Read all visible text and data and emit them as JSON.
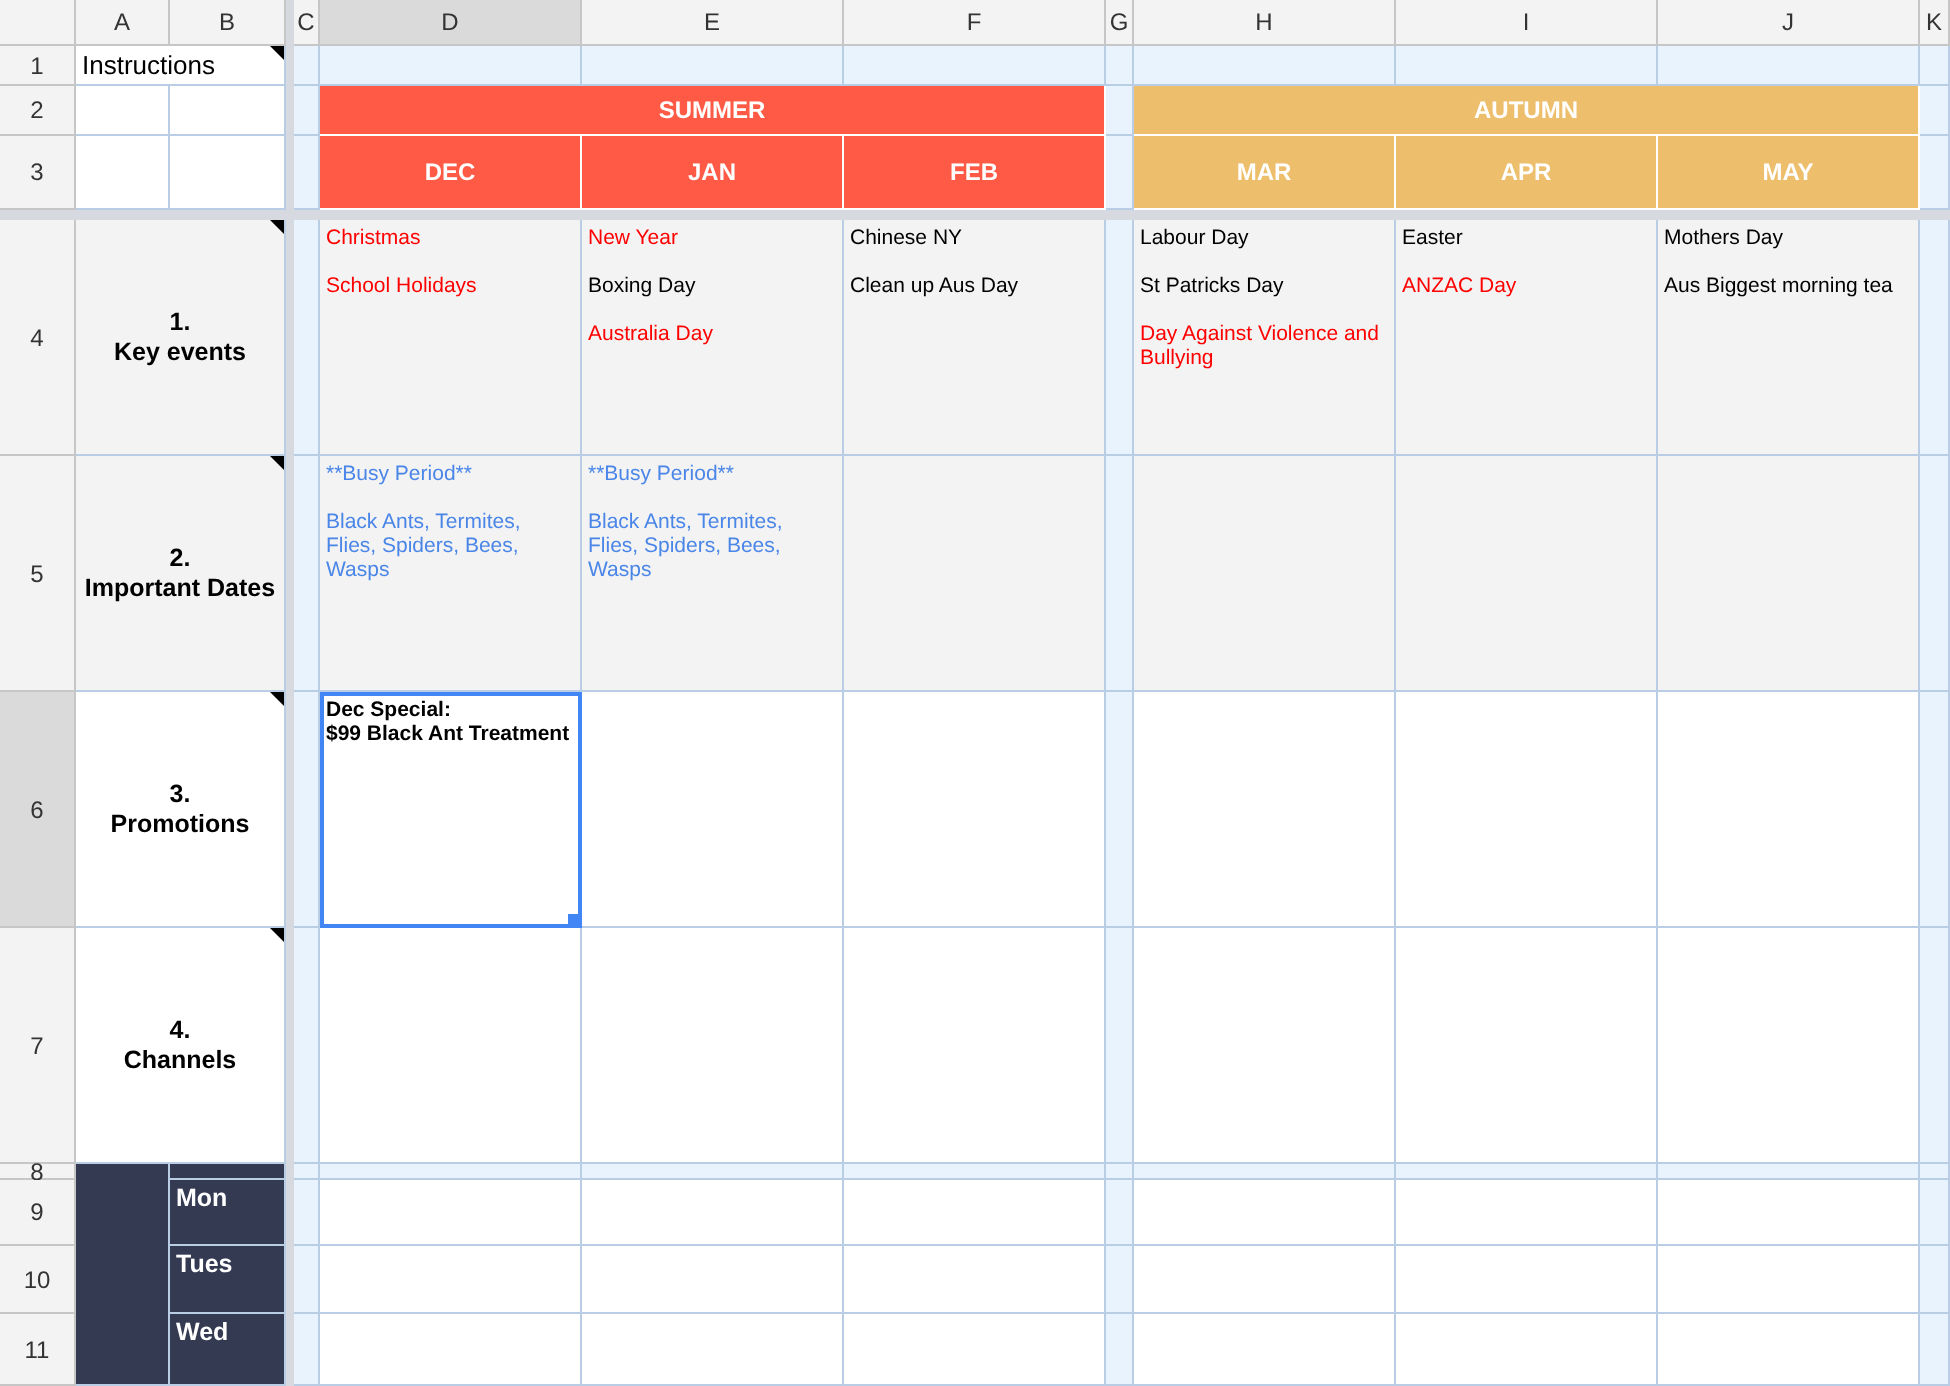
{
  "columns": [
    {
      "label": "A",
      "selected": false
    },
    {
      "label": "B",
      "selected": false
    },
    {
      "label": "C",
      "selected": false
    },
    {
      "label": "D",
      "selected": true
    },
    {
      "label": "E",
      "selected": false
    },
    {
      "label": "F",
      "selected": false
    },
    {
      "label": "G",
      "selected": false
    },
    {
      "label": "H",
      "selected": false
    },
    {
      "label": "I",
      "selected": false
    },
    {
      "label": "J",
      "selected": false
    },
    {
      "label": "K",
      "selected": false
    }
  ],
  "rows": [
    {
      "label": "1",
      "selected": false
    },
    {
      "label": "2",
      "selected": false
    },
    {
      "label": "3",
      "selected": false
    },
    {
      "label": "4",
      "selected": false
    },
    {
      "label": "5",
      "selected": false
    },
    {
      "label": "6",
      "selected": true
    },
    {
      "label": "7",
      "selected": false
    },
    {
      "label": "8",
      "selected": false
    },
    {
      "label": "9",
      "selected": false
    },
    {
      "label": "10",
      "selected": false
    },
    {
      "label": "11",
      "selected": false
    }
  ],
  "instructions": {
    "text": "Instructions",
    "note": true
  },
  "seasons": [
    {
      "name": "SUMMER",
      "color": "#ff5a45",
      "months": [
        "DEC",
        "JAN",
        "FEB"
      ]
    },
    {
      "name": "AUTUMN",
      "color": "#edbe6c",
      "months": [
        "MAR",
        "APR",
        "MAY"
      ]
    }
  ],
  "sections": [
    {
      "number": "1.",
      "title": "Key events",
      "note": true,
      "shaded": true,
      "cells": [
        [
          {
            "text": "Christmas",
            "color": "#ff0000"
          },
          {
            "text": "School Holidays",
            "color": "#ff0000"
          }
        ],
        [
          {
            "text": "New Year",
            "color": "#ff0000"
          },
          {
            "text": "Boxing Day",
            "color": "#000000"
          },
          {
            "text": "Australia Day",
            "color": "#ff0000"
          }
        ],
        [
          {
            "text": "Chinese NY",
            "color": "#000000"
          },
          {
            "text": "Clean up Aus Day",
            "color": "#000000"
          }
        ],
        [
          {
            "text": "Labour Day",
            "color": "#000000"
          },
          {
            "text": "St Patricks Day",
            "color": "#000000"
          },
          {
            "text": "Day Against Violence and Bullying",
            "color": "#ff0000"
          }
        ],
        [
          {
            "text": "Easter",
            "color": "#000000"
          },
          {
            "text": "ANZAC Day",
            "color": "#ff0000"
          }
        ],
        [
          {
            "text": "Mothers Day",
            "color": "#000000"
          },
          {
            "text": "Aus Biggest morning tea",
            "color": "#000000"
          }
        ]
      ]
    },
    {
      "number": "2.",
      "title": "Important Dates",
      "note": true,
      "shaded": true,
      "cells": [
        [
          {
            "text": "**Busy Period**",
            "color": "#4a86e8"
          },
          {
            "text": "Black Ants, Termites, Flies, Spiders, Bees, Wasps",
            "color": "#4a86e8"
          }
        ],
        [
          {
            "text": "**Busy Period**",
            "color": "#4a86e8"
          },
          {
            "text": "Black Ants, Termites, Flies, Spiders, Bees, Wasps",
            "color": "#4a86e8"
          }
        ],
        [],
        [],
        [],
        []
      ]
    },
    {
      "number": "3.",
      "title": "Promotions",
      "note": true,
      "shaded": false,
      "cells": [
        [
          {
            "text": "Dec Special:\n$99 Black Ant Treatment",
            "color": "#000000",
            "bold": true,
            "selected": true
          }
        ],
        [],
        [],
        [],
        [],
        []
      ]
    },
    {
      "number": "4.",
      "title": "Channels",
      "note": true,
      "shaded": false,
      "cells": [
        [],
        [],
        [],
        [],
        [],
        []
      ]
    }
  ],
  "week": {
    "days": [
      "Mon",
      "Tues",
      "Wed"
    ]
  }
}
